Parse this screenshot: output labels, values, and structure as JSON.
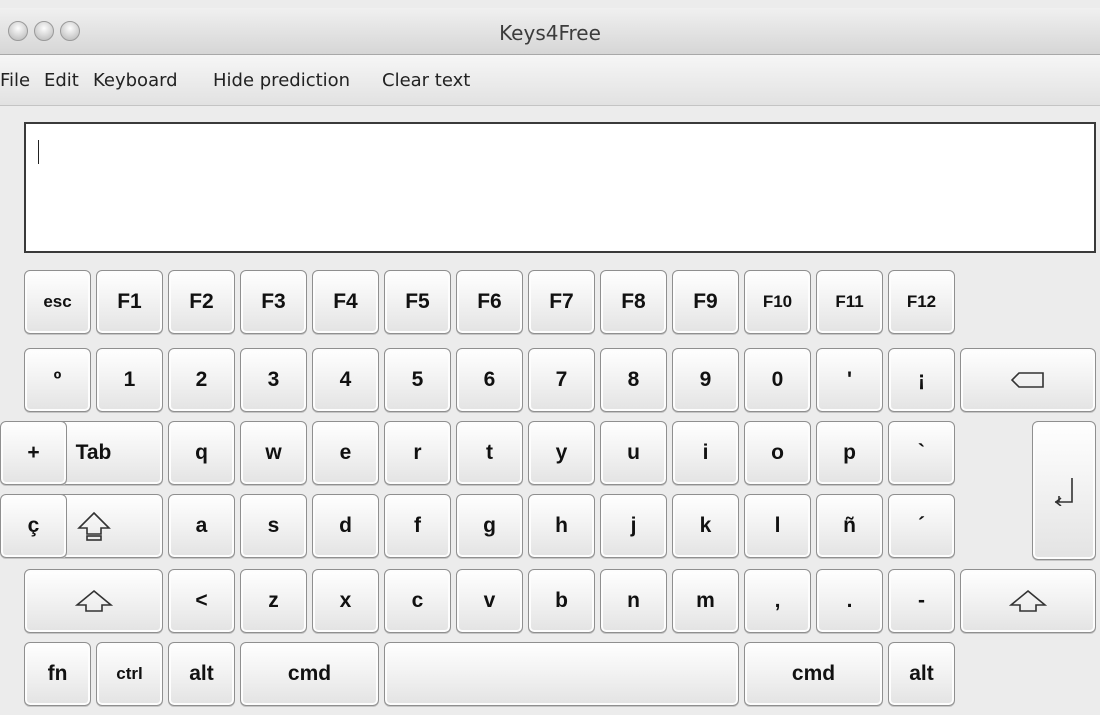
{
  "window": {
    "title": "Keys4Free"
  },
  "menu": [
    "File",
    "Edit",
    "Keyboard",
    "Hide prediction",
    "Clear text"
  ],
  "text_area": {
    "value": ""
  },
  "keyboard": {
    "row_fn": [
      "esc",
      "F1",
      "F2",
      "F3",
      "F4",
      "F5",
      "F6",
      "F7",
      "F8",
      "F9",
      "F10",
      "F11",
      "F12"
    ],
    "row_num": [
      "º",
      "1",
      "2",
      "3",
      "4",
      "5",
      "6",
      "7",
      "8",
      "9",
      "0",
      "'",
      "¡"
    ],
    "row_tab": [
      "Tab",
      "q",
      "w",
      "e",
      "r",
      "t",
      "y",
      "u",
      "i",
      "o",
      "p",
      "`",
      "+"
    ],
    "row_caps": [
      "a",
      "s",
      "d",
      "f",
      "g",
      "h",
      "j",
      "k",
      "l",
      "ñ",
      "´",
      "ç"
    ],
    "row_shift": [
      "<",
      "z",
      "x",
      "c",
      "v",
      "b",
      "n",
      "m",
      ",",
      ".",
      "-"
    ],
    "row_bottom": [
      "fn",
      "ctrl",
      "alt",
      "cmd",
      "",
      "cmd",
      "alt"
    ]
  },
  "icons": {
    "backspace": "backspace-icon",
    "enter": "return-icon",
    "caps_lock": "caps-lock-icon",
    "shift": "shift-icon"
  }
}
